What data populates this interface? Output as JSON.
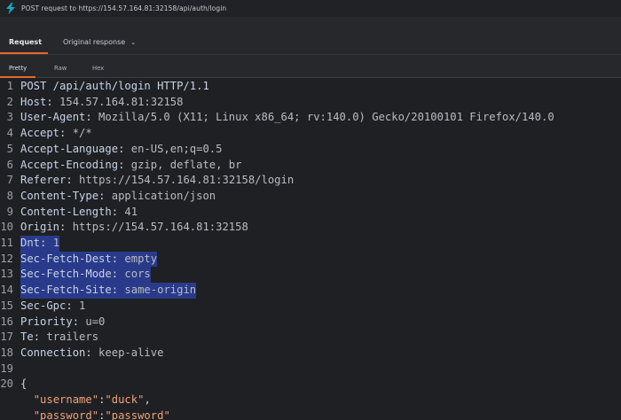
{
  "window": {
    "title": "POST request to https://154.57.164.81:32158/api/auth/login"
  },
  "tabs": {
    "request": "Request",
    "original": "Original response"
  },
  "subtabs": {
    "pretty": "Pretty",
    "raw": "Raw",
    "hex": "Hex"
  },
  "colors": {
    "accent": "#e46b2a",
    "highlight": "#2a3a8a",
    "brand": "#1aa7c4"
  },
  "lines": [
    {
      "n": "1",
      "k": "POST /api/auth/login HTTP/1.1",
      "v": ""
    },
    {
      "n": "2",
      "k": "Host",
      "v": " 154.57.164.81:32158"
    },
    {
      "n": "3",
      "k": "User-Agent",
      "v": " Mozilla/5.0 (X11; Linux x86_64; rv:140.0) Gecko/20100101 Firefox/140.0"
    },
    {
      "n": "4",
      "k": "Accept",
      "v": " */*"
    },
    {
      "n": "5",
      "k": "Accept-Language",
      "v": " en-US,en;q=0.5"
    },
    {
      "n": "6",
      "k": "Accept-Encoding",
      "v": " gzip, deflate, br"
    },
    {
      "n": "7",
      "k": "Referer",
      "v": " https://154.57.164.81:32158/login"
    },
    {
      "n": "8",
      "k": "Content-Type",
      "v": " application/json"
    },
    {
      "n": "9",
      "k": "Content-Length",
      "v": " 41"
    },
    {
      "n": "10",
      "k": "Origin",
      "v": " https://154.57.164.81:32158"
    },
    {
      "n": "11",
      "k": "Dnt",
      "v": " 1"
    },
    {
      "n": "12",
      "k": "Sec-Fetch-Dest",
      "v": " empty"
    },
    {
      "n": "13",
      "k": "Sec-Fetch-Mode",
      "v": " cors"
    },
    {
      "n": "14",
      "k": "Sec-Fetch-Site",
      "v": " same-origin"
    },
    {
      "n": "15",
      "k": "Sec-Gpc",
      "v": " 1"
    },
    {
      "n": "16",
      "k": "Priority",
      "v": " u=0"
    },
    {
      "n": "17",
      "k": "Te",
      "v": " trailers"
    },
    {
      "n": "18",
      "k": "Connection",
      "v": " keep-alive"
    },
    {
      "n": "19",
      "k": "",
      "v": ""
    },
    {
      "n": "20",
      "k": "{",
      "v": ""
    }
  ],
  "json_body": {
    "username_key": "\"username\"",
    "username_val": "\"duck\"",
    "password_key": "\"password\"",
    "password_val": "\"password\""
  }
}
